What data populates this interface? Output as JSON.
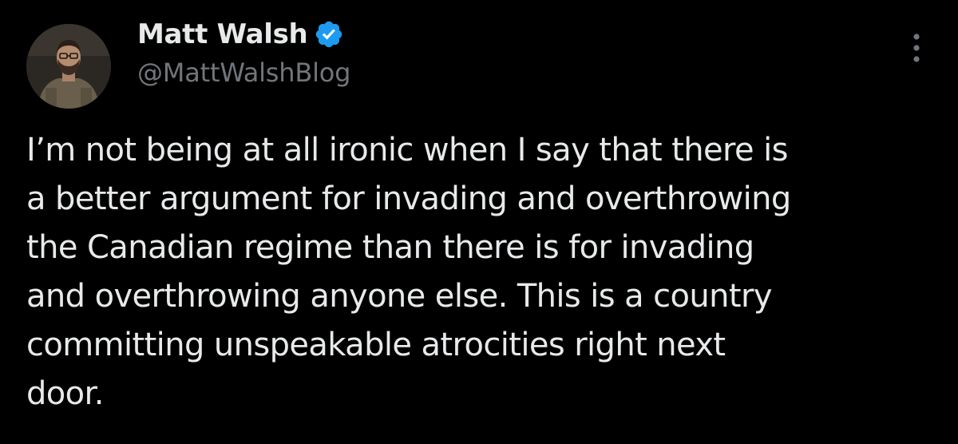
{
  "author": {
    "display_name": "Matt Walsh",
    "handle": "@MattWalshBlog",
    "verified": true
  },
  "tweet": {
    "lines": [
      "I’m not being at all ironic when I say that there is",
      "a better argument for invading and overthrowing",
      "the Canadian regime than there is for invading",
      "and overthrowing anyone else. This is a country",
      "committing unspeakable atrocities right next",
      "door."
    ]
  },
  "icons": {
    "verified": "verified-badge-icon",
    "more": "more-options-icon",
    "avatar": "profile-photo"
  },
  "colors": {
    "background": "#000000",
    "text_primary": "#e7e9ea",
    "text_secondary": "#71767b",
    "verified_blue": "#1d9bf0"
  }
}
